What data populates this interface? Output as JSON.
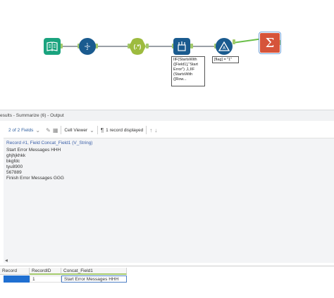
{
  "canvas": {
    "tools": [
      {
        "name": "input-data-tool-icon",
        "color": "#1aa37e"
      },
      {
        "name": "record-id-tool-icon",
        "color": "#1a5b8f"
      },
      {
        "name": "regex-tool-icon",
        "color": "#9dbb3f"
      },
      {
        "name": "formula-tool-icon",
        "color": "#1a5b8f"
      },
      {
        "name": "filter-tool-icon",
        "color": "#1a5b8f"
      },
      {
        "name": "summarize-tool-icon",
        "color": "#d6543a"
      }
    ],
    "formula_note": "IIF(StartsWith\n([Field1],\"Start\nError\") ,1,IIF\n(StartsWith\n([Row...",
    "filter_note": "[flag] = \"1\""
  },
  "results": {
    "header": "esults - Summarize (6) - Output"
  },
  "toolbar": {
    "fields_label": "2 of 2 Fields",
    "cell_viewer_label": "Cell Viewer",
    "records_label": "1 record displayed"
  },
  "viewer": {
    "title": "Record #1, Field Concat_Field1 (V_String)",
    "lines": [
      "Start Error Messages HHH",
      "ghjhjkhkk",
      "bkgfdc",
      "tyu8900",
      "567889",
      "Finish Error Messages GGG"
    ]
  },
  "grid": {
    "headers": [
      "Record",
      "RecordID",
      "Concat_Field1"
    ],
    "row": {
      "record": "",
      "record_id": "1",
      "concat": "Start Error Messages HHH"
    }
  }
}
